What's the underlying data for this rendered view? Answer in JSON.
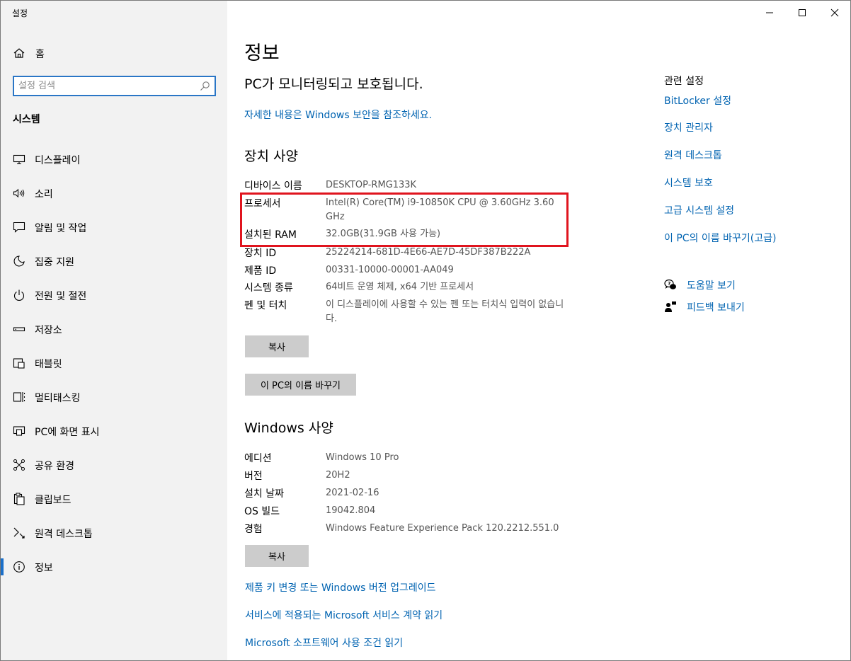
{
  "window": {
    "app_title": "설정",
    "controls": [
      "minimize",
      "maximize",
      "close"
    ]
  },
  "sidebar": {
    "home_label": "홈",
    "search_placeholder": "설정 검색",
    "section_title": "시스템",
    "items": [
      {
        "label": "디스플레이",
        "icon": "monitor-icon"
      },
      {
        "label": "소리",
        "icon": "speaker-icon"
      },
      {
        "label": "알림 및 작업",
        "icon": "notification-icon"
      },
      {
        "label": "집중 지원",
        "icon": "moon-icon"
      },
      {
        "label": "전원 및 절전",
        "icon": "power-icon"
      },
      {
        "label": "저장소",
        "icon": "storage-icon"
      },
      {
        "label": "태블릿",
        "icon": "tablet-icon"
      },
      {
        "label": "멀티태스킹",
        "icon": "multitasking-icon"
      },
      {
        "label": "PC에 화면 표시",
        "icon": "project-icon"
      },
      {
        "label": "공유 환경",
        "icon": "share-icon"
      },
      {
        "label": "클립보드",
        "icon": "clipboard-icon"
      },
      {
        "label": "원격 데스크톱",
        "icon": "remote-desktop-icon"
      },
      {
        "label": "정보",
        "icon": "info-icon",
        "active": true
      }
    ]
  },
  "main": {
    "title": "정보",
    "protection_text": "PC가 모니터링되고 보호됩니다.",
    "security_link": "자세한 내용은 Windows 보안을 참조하세요.",
    "device_specs": {
      "heading": "장치 사양",
      "rows": [
        {
          "key": "디바이스 이름",
          "value": "DESKTOP-RMG133K"
        },
        {
          "key": "프로세서",
          "value": "Intel(R) Core(TM) i9-10850K CPU @ 3.60GHz   3.60 GHz"
        },
        {
          "key": "설치된 RAM",
          "value": "32.0GB(31.9GB 사용 가능)"
        },
        {
          "key": "장치 ID",
          "value": "25224214-681D-4E66-AE7D-45DF387B222A"
        },
        {
          "key": "제품 ID",
          "value": "00331-10000-00001-AA049"
        },
        {
          "key": "시스템 종류",
          "value": "64비트 운영 체제, x64 기반 프로세서"
        },
        {
          "key": "펜 및 터치",
          "value": "이 디스플레이에 사용할 수 있는 펜 또는 터치식 입력이 없습니다."
        }
      ],
      "copy_button": "복사",
      "rename_button": "이 PC의 이름 바꾸기"
    },
    "windows_specs": {
      "heading": "Windows 사양",
      "rows": [
        {
          "key": "에디션",
          "value": "Windows 10 Pro"
        },
        {
          "key": "버전",
          "value": "20H2"
        },
        {
          "key": "설치 날짜",
          "value": "2021-02-16"
        },
        {
          "key": "OS 빌드",
          "value": "19042.804"
        },
        {
          "key": "경험",
          "value": "Windows Feature Experience Pack 120.2212.551.0"
        }
      ],
      "copy_button": "복사"
    },
    "bottom_links": [
      "제품 키 변경 또는 Windows 버전 업그레이드",
      "서비스에 적용되는 Microsoft 서비스 계약 읽기",
      "Microsoft 소프트웨어 사용 조건 읽기"
    ]
  },
  "related": {
    "title": "관련 설정",
    "links": [
      "BitLocker 설정",
      "장치 관리자",
      "원격 데스크톱",
      "시스템 보호",
      "고급 시스템 설정",
      "이 PC의 이름 바꾸기(고급)"
    ],
    "help": [
      {
        "label": "도움말 보기",
        "icon": "help-chat-icon"
      },
      {
        "label": "피드백 보내기",
        "icon": "feedback-icon"
      }
    ]
  },
  "colors": {
    "accent": "#0063b1",
    "highlight": "#e0141e",
    "sidebar_bg": "#f2f2f2",
    "button_bg": "#cccccc"
  }
}
